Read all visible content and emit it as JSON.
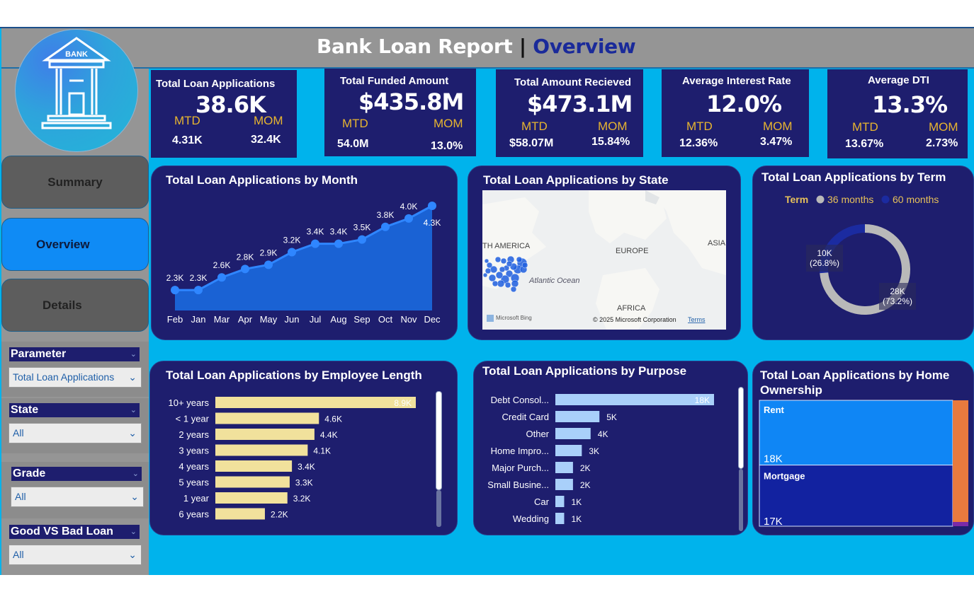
{
  "header": {
    "title_main": "Bank Loan Report",
    "title_sep": "|",
    "title_page": "Overview",
    "logo_text": "BANK"
  },
  "nav": {
    "summary": "Summary",
    "overview": "Overview",
    "details": "Details"
  },
  "slicers": [
    {
      "title": "Parameter",
      "value": "Total Loan Applications"
    },
    {
      "title": "State",
      "value": "All"
    },
    {
      "title": "Grade",
      "value": "All"
    },
    {
      "title": "Good VS Bad Loan",
      "value": "All"
    }
  ],
  "kpis": [
    {
      "title": "Total Loan  Applications",
      "value": "38.6K",
      "mtd_label": "MTD",
      "mom_label": "MOM",
      "mtd": "4.31K",
      "mom": "32.4K"
    },
    {
      "title": "Total Funded Amount",
      "value": "$435.8M",
      "mtd_label": "MTD",
      "mom_label": "MOM",
      "mtd": "54.0M",
      "mom": "13.0%"
    },
    {
      "title": "Total Amount Recieved",
      "value": "$473.1M",
      "mtd_label": "MTD",
      "mom_label": "MOM",
      "mtd": "$58.07M",
      "mom": "15.84%"
    },
    {
      "title": "Average Interest Rate",
      "value": "12.0%",
      "mtd_label": "MTD",
      "mom_label": "MOM",
      "mtd": "12.36%",
      "mom": "3.47%"
    },
    {
      "title": "Average DTI",
      "value": "13.3%",
      "mtd_label": "MTD",
      "mom_label": "MOM",
      "mtd": "13.67%",
      "mom": "2.73%"
    }
  ],
  "cards": {
    "month": "Total Loan Applications by Month",
    "state": "Total Loan Applications by State",
    "term": "Total Loan Applications by Term",
    "emp": "Total Loan Applications by Employee Length",
    "purpose": "Total Loan Applications by Purpose",
    "home_line1": "Total Loan Applications by Home",
    "home_line2": "Ownership"
  },
  "map": {
    "labels": {
      "america": "TH AMERICA",
      "europe": "EUROPE",
      "asia": "ASIA",
      "ocean": "Atlantic Ocean",
      "africa": "AFRICA"
    },
    "brand": "Microsoft Bing",
    "copyright": "© 2025 Microsoft Corporation",
    "terms": "Terms"
  },
  "chart_data": [
    {
      "type": "area",
      "categories": [
        "Feb",
        "Jan",
        "Mar",
        "Apr",
        "May",
        "Jun",
        "Jul",
        "Aug",
        "Sep",
        "Oct",
        "Nov",
        "Dec"
      ],
      "values": [
        2.3,
        2.3,
        2.6,
        2.8,
        2.9,
        3.2,
        3.4,
        3.4,
        3.5,
        3.8,
        4.0,
        4.3
      ],
      "data_labels": [
        "2.3K",
        "2.3K",
        "2.6K",
        "2.8K",
        "2.9K",
        "3.2K",
        "3.4K",
        "3.4K",
        "3.5K",
        "3.8K",
        "4.0K",
        "4.3K"
      ],
      "unit": "K",
      "color": "#1a6fe6"
    },
    {
      "type": "donut",
      "legend_title": "Term",
      "legend_placement": "top",
      "slices": [
        {
          "name": "36 months",
          "value": 28,
          "label": "28K",
          "pct": "(73.2%)",
          "color": "#b9b9b9"
        },
        {
          "name": "60 months",
          "value": 10,
          "label": "10K",
          "pct": "(26.8%)",
          "color": "#1b2ba0"
        }
      ]
    },
    {
      "type": "bar",
      "orientation": "horizontal",
      "categories": [
        "10+ years",
        "< 1 year",
        "2 years",
        "3 years",
        "4 years",
        "5 years",
        "1 year",
        "6 years"
      ],
      "values": [
        8.9,
        4.6,
        4.4,
        4.1,
        3.4,
        3.3,
        3.2,
        2.2
      ],
      "data_labels": [
        "8.9K",
        "4.6K",
        "4.4K",
        "4.1K",
        "3.4K",
        "3.3K",
        "3.2K",
        "2.2K"
      ],
      "color": "#F1E19C"
    },
    {
      "type": "bar",
      "orientation": "horizontal",
      "categories": [
        "Debt Consol...",
        "Credit Card",
        "Other",
        "Home Impro...",
        "Major Purch...",
        "Small Busine...",
        "Car",
        "Wedding"
      ],
      "values": [
        18,
        5,
        4,
        3,
        2,
        2,
        1,
        1
      ],
      "data_labels": [
        "18K",
        "5K",
        "4K",
        "3K",
        "2K",
        "2K",
        "1K",
        "1K"
      ],
      "color": "#A9D0FA"
    },
    {
      "type": "treemap",
      "items": [
        {
          "name": "Rent",
          "value": 18,
          "label": "18K",
          "color": "#0f86f5"
        },
        {
          "name": "Mortgage",
          "value": 17,
          "label": "17K",
          "color": "#1222a0"
        },
        {
          "name": "",
          "value": 3,
          "label": "",
          "color": "#e87a3e"
        },
        {
          "name": "",
          "value": 0.05,
          "label": "",
          "color": "#7a2aa8"
        }
      ]
    }
  ]
}
